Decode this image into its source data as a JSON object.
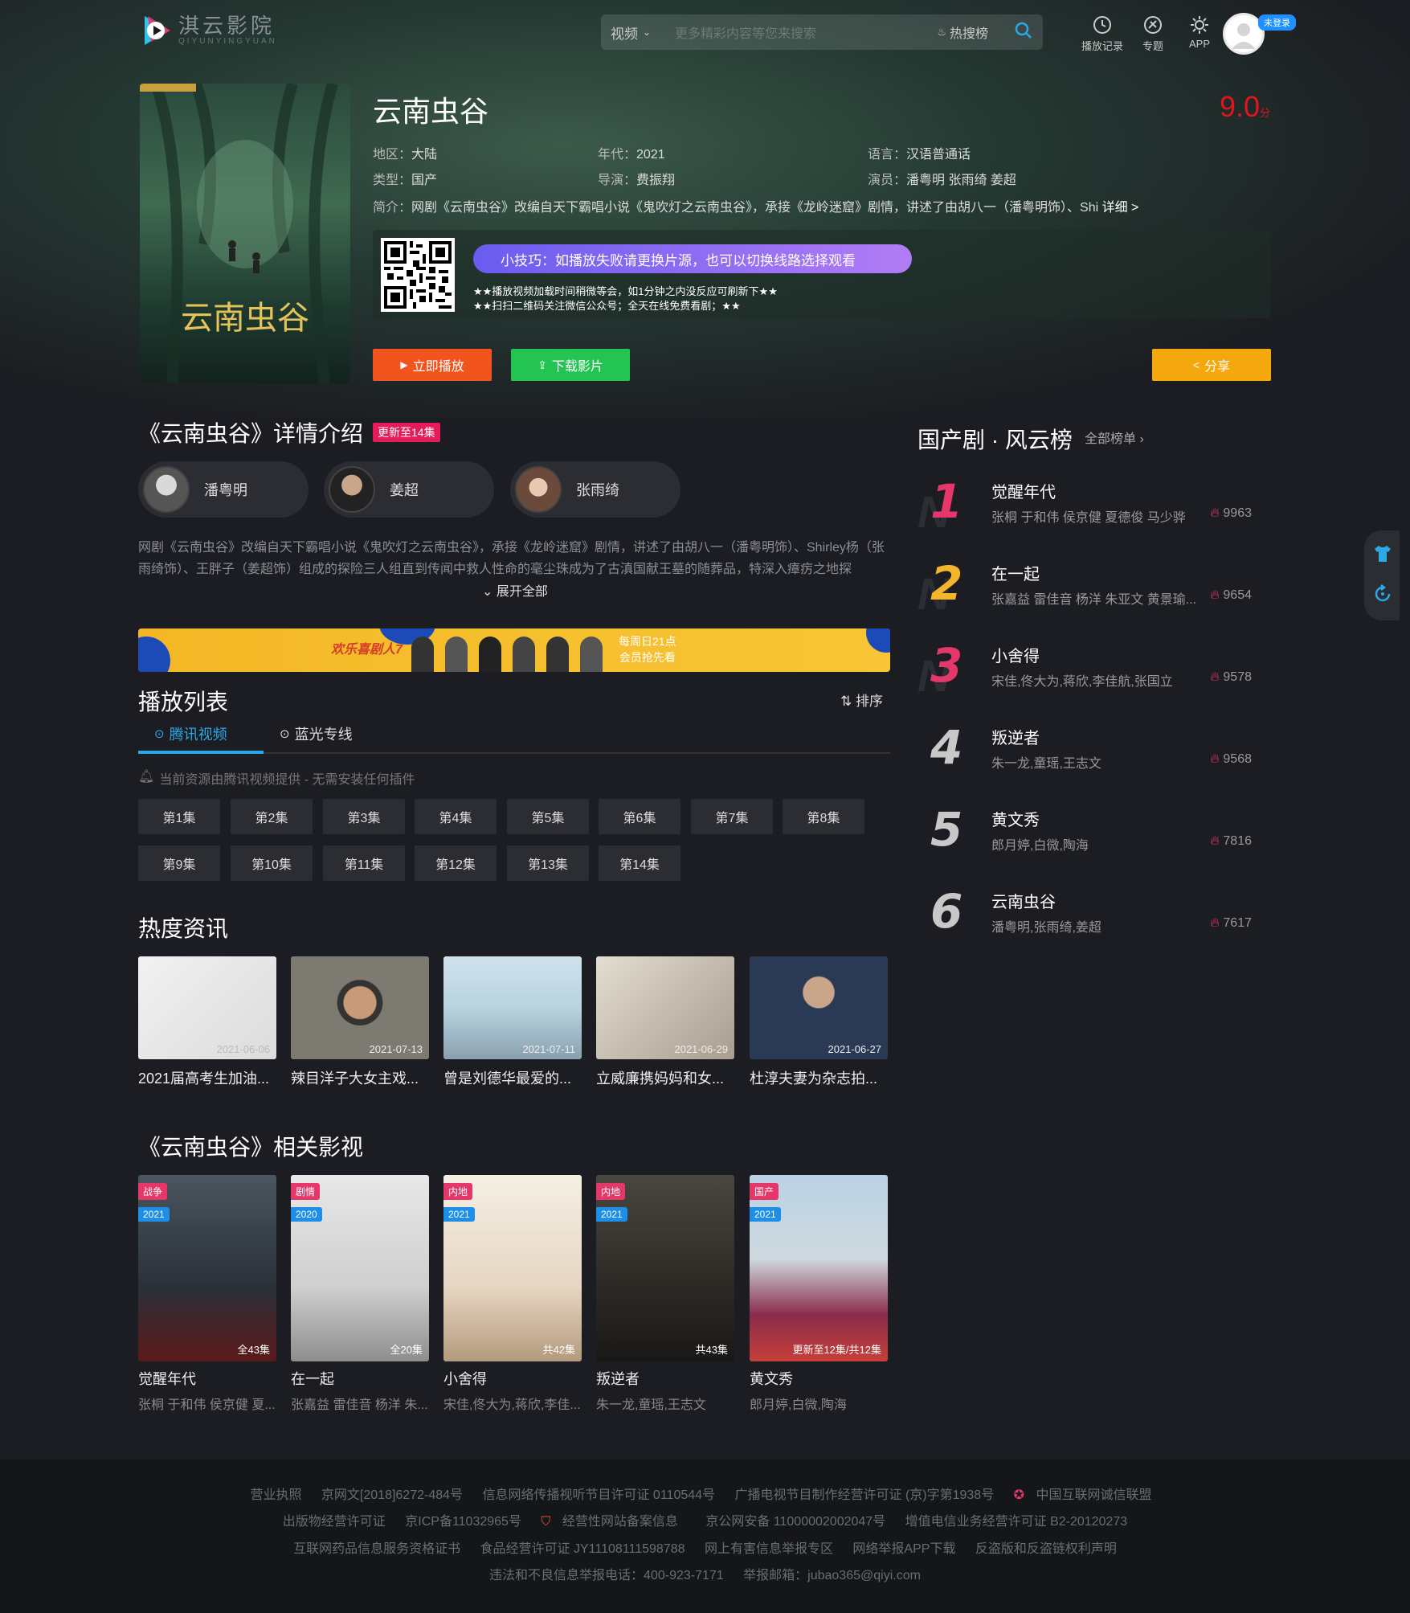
{
  "header": {
    "logo_text": "淇云影院",
    "logo_sub": "QIYUNYINGYUAN",
    "search_category": "视频",
    "search_placeholder": "更多精彩内容等您来搜索",
    "hot_label": "热搜榜",
    "icons": [
      {
        "label": "播放记录",
        "icon": "clock-icon"
      },
      {
        "label": "专题",
        "icon": "topic-icon"
      },
      {
        "label": "APP",
        "icon": "app-icon"
      }
    ],
    "login_badge": "未登录"
  },
  "movie": {
    "title": "云南虫谷",
    "score": "9.0",
    "score_unit": "分",
    "region_label": "地区：",
    "region": "大陆",
    "year_label": "年代：",
    "year": "2021",
    "lang_label": "语言：",
    "lang": "汉语普通话",
    "type_label": "类型：",
    "type": "国产",
    "director_label": "导演：",
    "director": "费振翔",
    "cast_label": "演员：",
    "cast": "潘粤明 张雨绮 姜超",
    "intro_label": "简介：",
    "intro": "网剧《云南虫谷》改编自天下霸唱小说《鬼吹灯之云南虫谷》，承接《龙岭迷窟》剧情，讲述了由胡八一（潘粤明饰）、Shi",
    "intro_more": "详细 >",
    "tip": "小技巧：如播放失败请更换片源，也可以切换线路选择观看",
    "tip_line1": "★★播放视频加载时间稍微等会，如1分钟之内没反应可刷新下★★",
    "tip_line2": "★★扫扫二维码关注微信公众号；全天在线免费看剧；★★",
    "btn_play": "立即播放",
    "btn_download": "下载影片",
    "btn_share": "分享"
  },
  "detail": {
    "title": "《云南虫谷》详情介绍",
    "update_badge": "更新至14集",
    "actors": [
      "潘粤明",
      "姜超",
      "张雨绮"
    ],
    "description": "网剧《云南虫谷》改编自天下霸唱小说《鬼吹灯之云南虫谷》，承接《龙岭迷窟》剧情，讲述了由胡八一（潘粤明饰）、Shirley杨（张雨绮饰）、王胖子（姜超饰）组成的探险三人组直到传闻中救人性命的毫尘珠成为了古滇国献王墓的随葬品，特深入瘴疠之地探",
    "expand": "展开全部",
    "banner_left": "欢乐喜剧人7",
    "banner_right1": "每周日21点",
    "banner_right2": "会员抢先看"
  },
  "playlist": {
    "title": "播放列表",
    "sort": "排序",
    "tabs": [
      "腾讯视频",
      "蓝光专线"
    ],
    "notice": "当前资源由腾讯视频提供 - 无需安装任何插件",
    "episodes": [
      "第1集",
      "第2集",
      "第3集",
      "第4集",
      "第5集",
      "第6集",
      "第7集",
      "第8集",
      "第9集",
      "第10集",
      "第11集",
      "第12集",
      "第13集",
      "第14集"
    ]
  },
  "news": {
    "title": "热度资讯",
    "items": [
      {
        "date": "2021-06-06",
        "caption": "2021届高考生加油..."
      },
      {
        "date": "2021-07-13",
        "caption": "辣目洋子大女主戏..."
      },
      {
        "date": "2021-07-11",
        "caption": "曾是刘德华最爱的..."
      },
      {
        "date": "2021-06-29",
        "caption": "立威廉携妈妈和女..."
      },
      {
        "date": "2021-06-27",
        "caption": "杜淳夫妻为杂志拍..."
      }
    ]
  },
  "related": {
    "title": "《云南虫谷》相关影视",
    "items": [
      {
        "genre": "战争",
        "year": "2021",
        "eps": "全43集",
        "name": "觉醒年代",
        "cast": "张桐 于和伟 侯京健 夏..."
      },
      {
        "genre": "剧情",
        "year": "2020",
        "eps": "全20集",
        "name": "在一起",
        "cast": "张嘉益 雷佳音 杨洋 朱..."
      },
      {
        "genre": "内地",
        "year": "2021",
        "eps": "共42集",
        "name": "小舍得",
        "cast": "宋佳,佟大为,蒋欣,李佳..."
      },
      {
        "genre": "内地",
        "year": "2021",
        "eps": "共43集",
        "name": "叛逆者",
        "cast": "朱一龙,童瑶,王志文"
      },
      {
        "genre": "国产",
        "year": "2021",
        "eps": "更新至12集/共12集",
        "name": "黄文秀",
        "cast": "郎月婷,白微,陶海"
      }
    ]
  },
  "ranking": {
    "title": "国产剧 · 风云榜",
    "all_link": "全部榜单",
    "items": [
      {
        "rank": "1",
        "name": "觉醒年代",
        "cast": "张桐 于和伟 侯京健 夏德俊 马少骅",
        "hot": "9963",
        "color": "#e5376a"
      },
      {
        "rank": "2",
        "name": "在一起",
        "cast": "张嘉益 雷佳音 杨洋 朱亚文 黄景瑜...",
        "hot": "9654",
        "color": "#f5b52a"
      },
      {
        "rank": "3",
        "name": "小舍得",
        "cast": "宋佳,佟大为,蒋欣,李佳航,张国立",
        "hot": "9578",
        "color": "#e5376a"
      },
      {
        "rank": "4",
        "name": "叛逆者",
        "cast": "朱一龙,童瑶,王志文",
        "hot": "9568",
        "color": "#c8c8c8"
      },
      {
        "rank": "5",
        "name": "黄文秀",
        "cast": "郎月婷,白微,陶海",
        "hot": "7816",
        "color": "#c8c8c8"
      },
      {
        "rank": "6",
        "name": "云南虫谷",
        "cast": "潘粤明,张雨绮,姜超",
        "hot": "7617",
        "color": "#c8c8c8"
      }
    ]
  },
  "footer": {
    "row1": [
      "营业执照",
      "京网文[2018]6272-484号",
      "信息网络传播视听节目许可证 0110544号",
      "广播电视节目制作经营许可证 (京)字第1938号",
      "中国互联网诚信联盟"
    ],
    "row2": [
      "出版物经营许可证",
      "京ICP备11032965号",
      "经营性网站备案信息",
      "京公网安备 11000002002047号",
      "增值电信业务经营许可证 B2-20120273"
    ],
    "row3": [
      "互联网药品信息服务资格证书",
      "食品经营许可证 JY11108111598788",
      "网上有害信息举报专区",
      "网络举报APP下载",
      "反盗版和反盗链权利声明"
    ],
    "row4": [
      "违法和不良信息举报电话：400-923-7171",
      "举报邮箱：jubao365@qiyi.com"
    ]
  }
}
